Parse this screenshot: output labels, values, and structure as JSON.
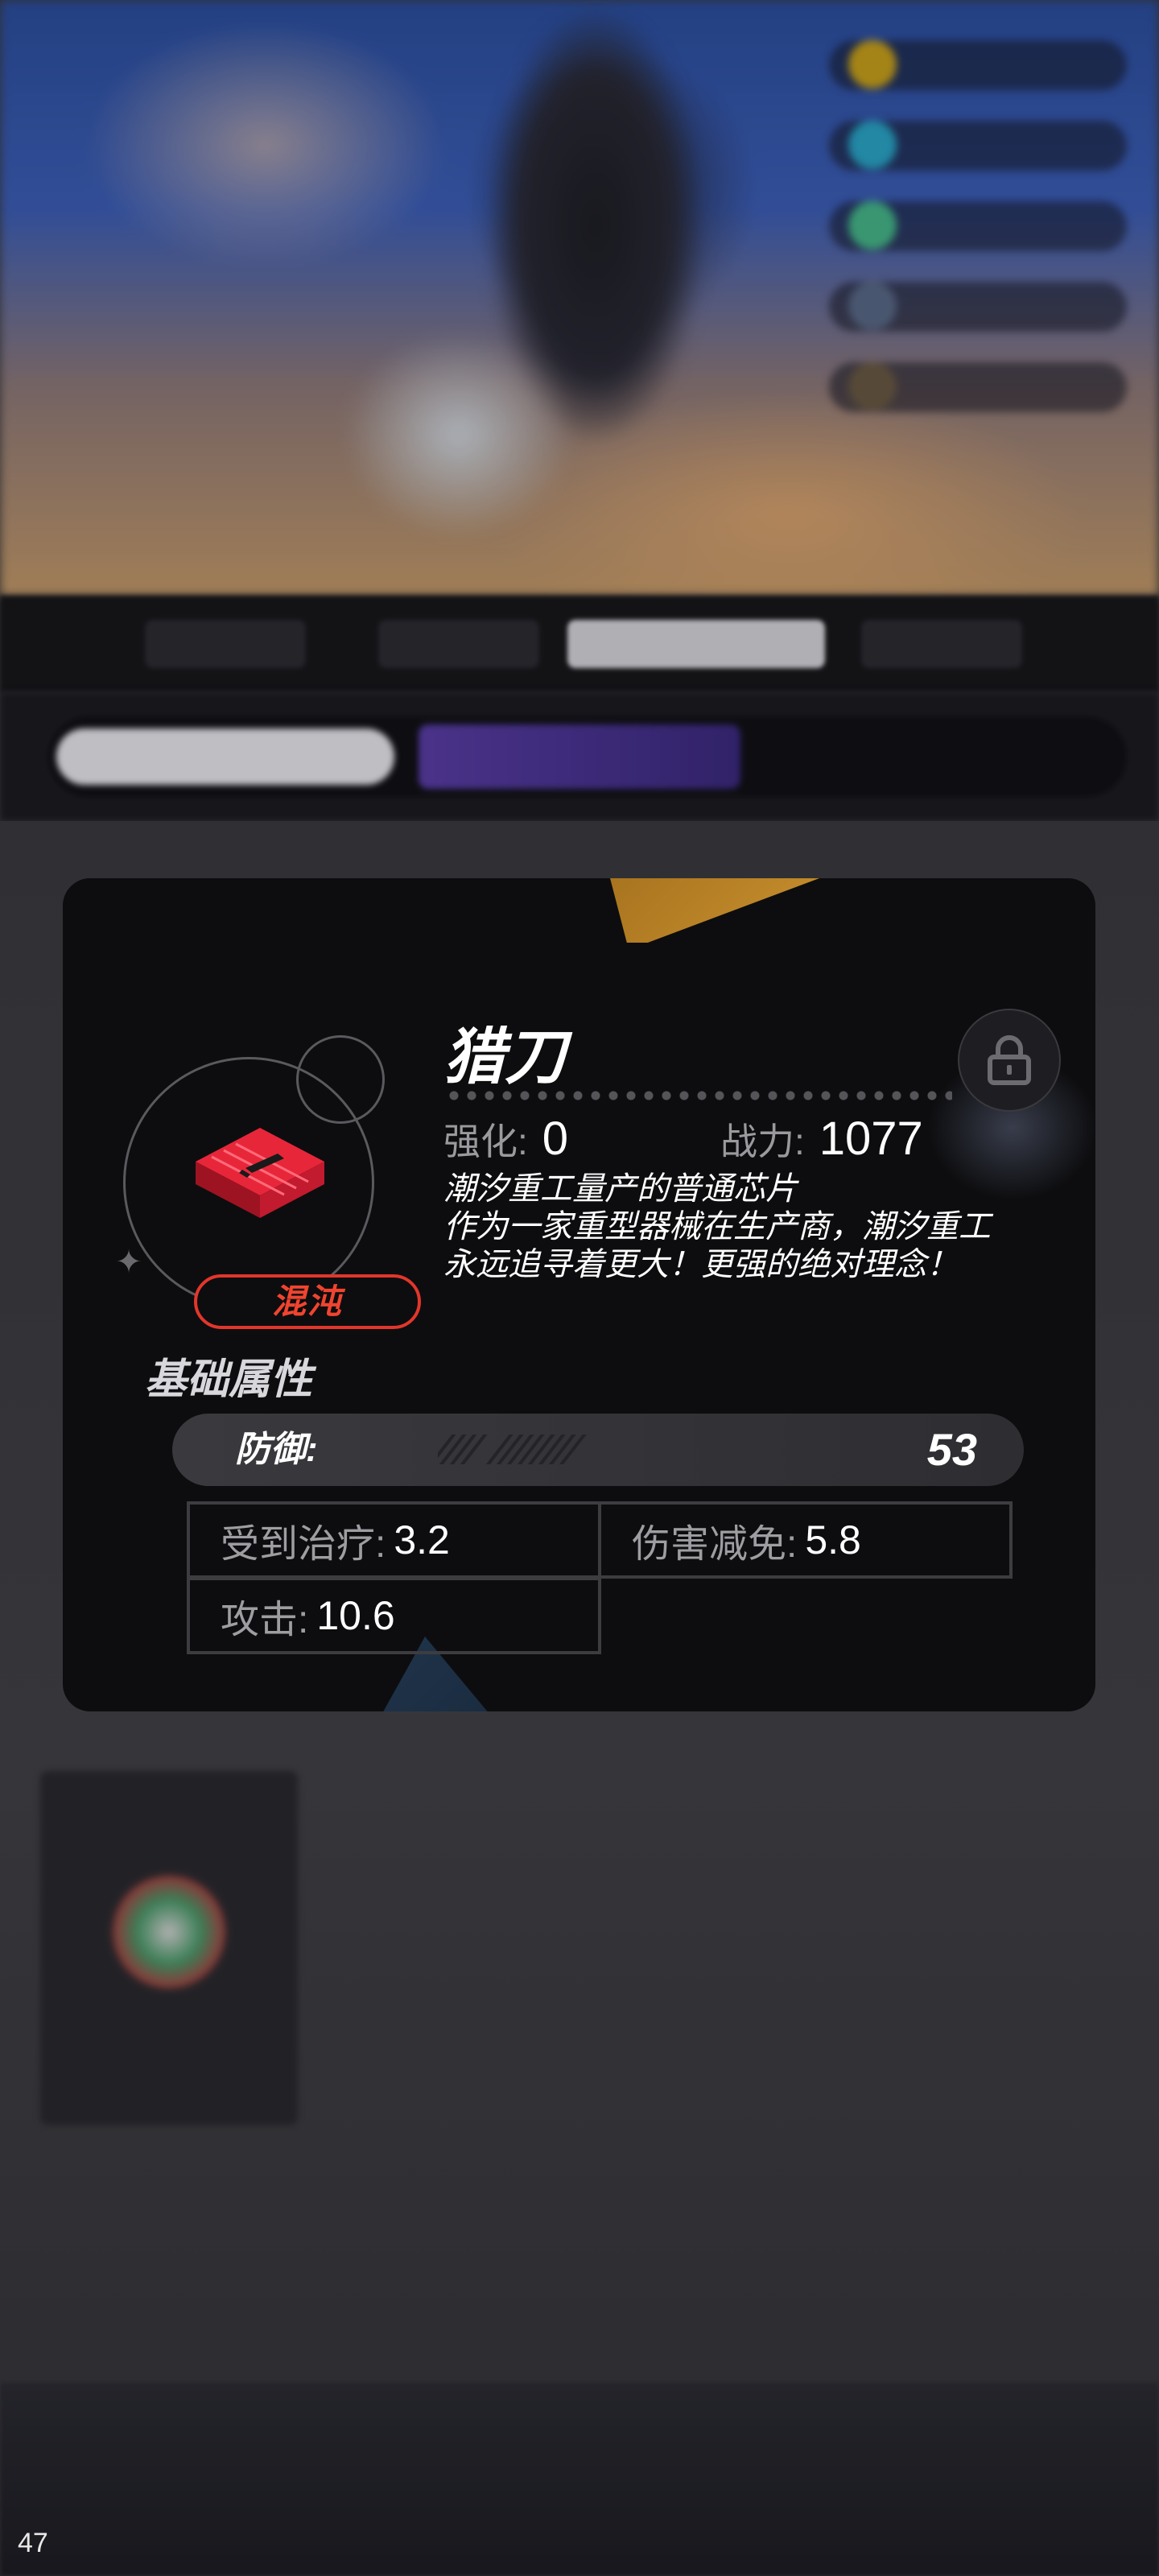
{
  "item": {
    "name": "猎刀",
    "rarity": "混沌",
    "enhance_label": "强化:",
    "enhance_value": "0",
    "power_label": "战力:",
    "power_value": "1077",
    "description": [
      "潮汐重工量产的普通芯片",
      "作为一家重型器械在生产商，潮汐重工",
      "永远追寻着更大！更强的绝对理念！"
    ]
  },
  "base_attributes": {
    "title": "基础属性",
    "primary": {
      "label": "防御:",
      "value": "53"
    },
    "substats": [
      {
        "label": "受到治疗:",
        "value": "3.2"
      },
      {
        "label": "伤害减免:",
        "value": "5.8"
      },
      {
        "label": "攻击:",
        "value": "10.6"
      }
    ]
  },
  "fps_counter": "47",
  "icons": {
    "lock": "lock-icon",
    "chip": "chip-icon",
    "sparkle": "sparkle-icon"
  },
  "colors": {
    "rarity_red": "#e2362b",
    "card_bg": "#0d0d0f",
    "label_gray": "#9a9a9e"
  }
}
